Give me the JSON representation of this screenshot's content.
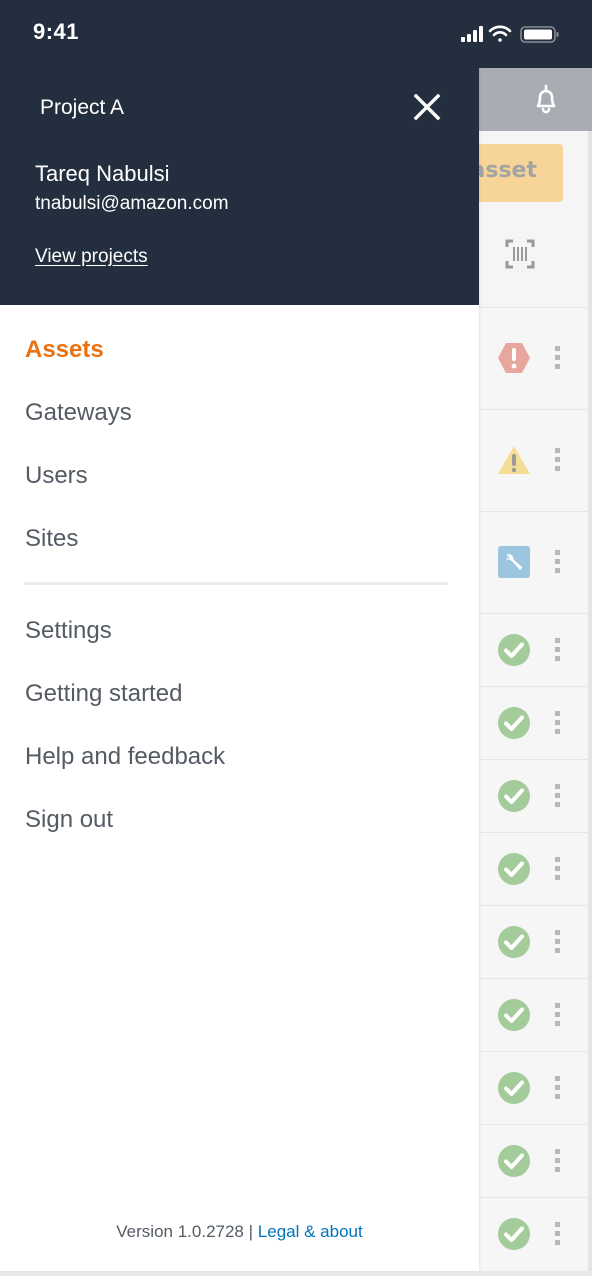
{
  "status_bar": {
    "time": "9:41",
    "icons": [
      "cellular-signal-icon",
      "wifi-icon",
      "battery-icon"
    ]
  },
  "drawer": {
    "project_title": "Project A",
    "close_icon": "close-icon",
    "user": {
      "name": "Tareq Nabulsi",
      "email": "tnabulsi@amazon.com"
    },
    "view_projects_label": "View projects",
    "nav_primary": [
      {
        "label": "Assets",
        "active": true
      },
      {
        "label": "Gateways",
        "active": false
      },
      {
        "label": "Users",
        "active": false
      },
      {
        "label": "Sites",
        "active": false
      }
    ],
    "nav_secondary": [
      {
        "label": "Settings"
      },
      {
        "label": "Getting started"
      },
      {
        "label": "Help and feedback"
      },
      {
        "label": "Sign out"
      }
    ],
    "footer": {
      "version": "Version 1.0.2728",
      "separator": "|",
      "legal_label": "Legal & about"
    }
  },
  "background_app": {
    "notification_icon": "bell-icon",
    "add_button_partial_label": "asset",
    "scan_icon": "barcode-scan-icon",
    "asset_rows": [
      {
        "status": "critical",
        "icon": "error-octagon-icon"
      },
      {
        "status": "warning",
        "icon": "warning-triangle-icon"
      },
      {
        "status": "maintenance",
        "icon": "wrench-icon"
      },
      {
        "status": "ok",
        "icon": "check-circle-icon"
      },
      {
        "status": "ok",
        "icon": "check-circle-icon"
      },
      {
        "status": "ok",
        "icon": "check-circle-icon"
      },
      {
        "status": "ok",
        "icon": "check-circle-icon"
      },
      {
        "status": "ok",
        "icon": "check-circle-icon"
      },
      {
        "status": "ok",
        "icon": "check-circle-icon"
      },
      {
        "status": "ok",
        "icon": "check-circle-icon"
      },
      {
        "status": "ok",
        "icon": "check-circle-icon"
      },
      {
        "status": "ok",
        "icon": "check-circle-icon"
      }
    ]
  },
  "colors": {
    "header_bg": "#232f3e",
    "active_nav": "#ec7211",
    "nav_text": "#545b64",
    "link": "#0073bb",
    "status_critical": "#e8a79e",
    "status_warning": "#f5dd96",
    "status_maintenance": "#9cc5e0",
    "status_ok": "#a3cc9a"
  }
}
